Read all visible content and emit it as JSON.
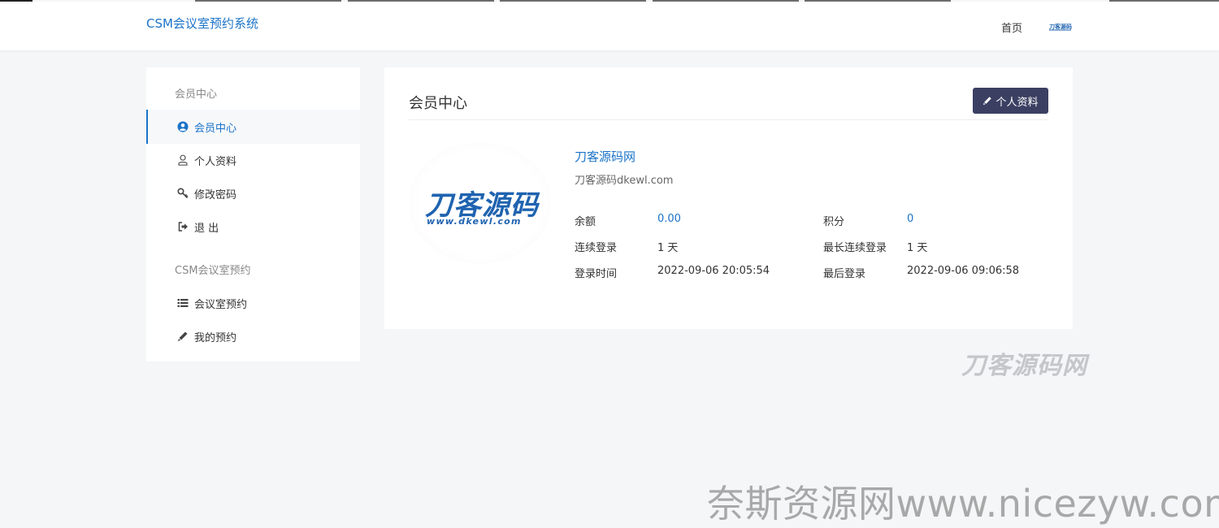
{
  "brand": "CSM会议室预约系统",
  "nav": {
    "home": "首页"
  },
  "sidebar": {
    "section1_title": "会员中心",
    "section1_items": [
      {
        "label": "会员中心",
        "icon": "user-circle-icon",
        "active": true
      },
      {
        "label": "个人资料",
        "icon": "user-outline-icon",
        "active": false
      },
      {
        "label": "修改密码",
        "icon": "key-icon",
        "active": false
      },
      {
        "label": "退 出",
        "icon": "sign-out-icon",
        "active": false
      }
    ],
    "section2_title": "CSM会议室预约",
    "section2_items": [
      {
        "label": "会议室预约",
        "icon": "list-icon"
      },
      {
        "label": "我的预约",
        "icon": "pencil-icon"
      }
    ]
  },
  "panel": {
    "title": "会员中心",
    "profile_button": "个人资料",
    "logo_text": "刀客源码",
    "logo_sub": "www.dkewl.com",
    "username": "刀客源码网",
    "signature": "刀客源码dkewl.com",
    "stats": {
      "balance_label": "余额",
      "balance_value": "0.00",
      "score_label": "积分",
      "score_value": "0",
      "cont_login_label": "连续登录",
      "cont_login_value": "1 天",
      "max_cont_label": "最长连续登录",
      "max_cont_value": "1 天",
      "login_time_label": "登录时间",
      "login_time_value": "2022-09-06 20:05:54",
      "last_login_label": "最后登录",
      "last_login_value": "2022-09-06 09:06:58"
    }
  },
  "watermarks": {
    "mid": "刀客源码网",
    "bottom": "奈斯资源网www.nicezyw.com"
  },
  "colors": {
    "accent": "#1a73c8",
    "button_bg": "#3b4062",
    "background": "#f4f6f8"
  }
}
